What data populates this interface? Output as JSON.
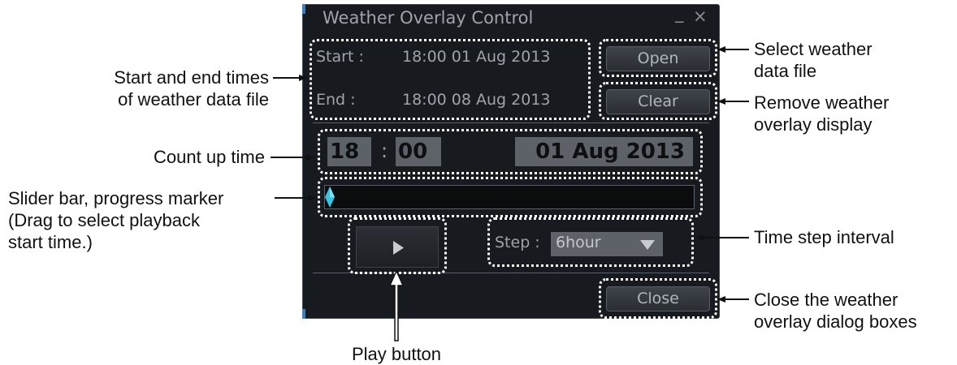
{
  "dialog": {
    "title": "Weather Overlay Control",
    "minimize_glyph": "_",
    "close_glyph": "×",
    "start_label": "Start :",
    "start_value": "18:00  01 Aug 2013",
    "end_label": "End :",
    "end_value": "18:00  08 Aug 2013",
    "open_label": "Open",
    "clear_label": "Clear",
    "count_hour": "18",
    "count_sep": ":",
    "count_minute": "00",
    "count_date": "01 Aug 2013",
    "slider_progress": 0,
    "play_icon": "play-icon",
    "step_label": "Step :",
    "step_value": "6hour",
    "close_label": "Close"
  },
  "annotations": {
    "start_end": [
      "Start and end times",
      "of weather data file"
    ],
    "count_up": "Count up time",
    "slider": [
      "Slider bar, progress marker",
      "(Drag to select playback",
      "start time.)"
    ],
    "open": [
      "Select weather",
      "data file"
    ],
    "clear": [
      "Remove weather",
      "overlay display"
    ],
    "step": "Time step interval",
    "close": [
      "Close the weather",
      "overlay dialog boxes"
    ],
    "play": "Play button"
  },
  "colors": {
    "dialog_bg": "#171a1e",
    "text": "#9ea4ab",
    "marker": "#35c3e6",
    "annotation_outline": "#ffffff"
  }
}
